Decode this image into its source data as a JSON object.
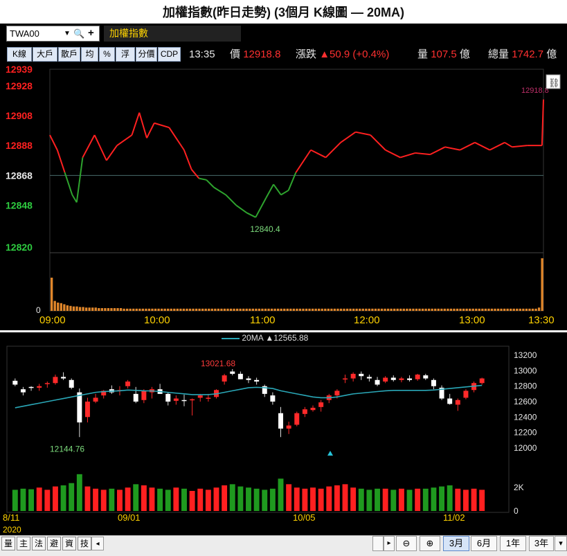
{
  "page_title": "加權指數(昨日走勢) (3個月 K線圖 — 20MA)",
  "symbol": {
    "code": "TWA00",
    "name": "加權指數"
  },
  "toolbar_buttons": [
    "K線",
    "大戶",
    "散戶",
    "均",
    "%",
    "浮",
    "分價",
    "CDP"
  ],
  "quote": {
    "time": "13:35",
    "price_label": "價",
    "price": "12918.8",
    "change_label": "漲跌",
    "change": "▲50.9 (+0.4%)",
    "volume_label": "量",
    "volume": "107.5",
    "unit1": "億",
    "total_label": "總量",
    "total": "1742.7",
    "unit2": "億"
  },
  "colors": {
    "up": "#ff2020",
    "down": "#1f9a1f",
    "ma": "#2aa8b8",
    "reference": "#4a6b6b"
  },
  "chart_data": [
    {
      "type": "line",
      "title": "intraday",
      "reference_price": 12868,
      "ylim": [
        12820,
        12939
      ],
      "y_ticks": [
        12939,
        12928,
        12908,
        12888,
        12868,
        12848,
        12820
      ],
      "x_ticks": [
        "09:00",
        "10:00",
        "11:00",
        "12:00",
        "13:00",
        "13:30"
      ],
      "min_label": "12840.4",
      "last_label": "12918.8",
      "volume_ylim_label": "0",
      "points": [
        [
          0,
          12895
        ],
        [
          5,
          12885
        ],
        [
          10,
          12870
        ],
        [
          15,
          12855
        ],
        [
          18,
          12850
        ],
        [
          22,
          12880
        ],
        [
          30,
          12895
        ],
        [
          38,
          12878
        ],
        [
          45,
          12888
        ],
        [
          55,
          12895
        ],
        [
          60,
          12910
        ],
        [
          65,
          12893
        ],
        [
          70,
          12903
        ],
        [
          80,
          12900
        ],
        [
          90,
          12885
        ],
        [
          95,
          12872
        ],
        [
          100,
          12866
        ],
        [
          105,
          12865
        ],
        [
          110,
          12860
        ],
        [
          118,
          12855
        ],
        [
          125,
          12848
        ],
        [
          132,
          12843
        ],
        [
          138,
          12840
        ],
        [
          145,
          12853
        ],
        [
          150,
          12862
        ],
        [
          155,
          12855
        ],
        [
          160,
          12858
        ],
        [
          165,
          12870
        ],
        [
          175,
          12885
        ],
        [
          185,
          12880
        ],
        [
          195,
          12890
        ],
        [
          205,
          12897
        ],
        [
          215,
          12895
        ],
        [
          225,
          12885
        ],
        [
          235,
          12880
        ],
        [
          245,
          12883
        ],
        [
          255,
          12882
        ],
        [
          265,
          12887
        ],
        [
          275,
          12885
        ],
        [
          285,
          12890
        ],
        [
          295,
          12885
        ],
        [
          305,
          12890
        ],
        [
          310,
          12887
        ],
        [
          320,
          12888
        ],
        [
          330,
          12888
        ],
        [
          331,
          12918.8
        ]
      ],
      "volume": [
        60,
        18,
        15,
        14,
        12,
        10,
        9,
        8,
        8,
        7,
        7,
        6,
        6,
        6,
        6,
        5,
        5,
        5,
        5,
        5,
        5,
        5,
        5,
        4,
        4,
        4,
        4,
        4,
        4,
        4,
        4,
        4,
        4,
        4,
        4,
        4,
        4,
        4,
        4,
        4,
        4,
        4,
        4,
        4,
        4,
        4,
        4,
        4,
        4,
        4,
        4,
        4,
        4,
        4,
        4,
        4,
        4,
        4,
        4,
        4,
        4,
        4,
        4,
        4,
        4,
        4,
        4,
        4,
        4,
        4,
        4,
        4,
        4,
        4,
        4,
        4,
        4,
        4,
        4,
        4,
        4,
        4,
        4,
        4,
        4,
        4,
        4,
        4,
        4,
        4,
        4,
        4,
        4,
        4,
        4,
        4,
        4,
        4,
        4,
        4,
        4,
        4,
        4,
        4,
        4,
        4,
        4,
        4,
        4,
        4,
        4,
        4,
        4,
        4,
        4,
        4,
        4,
        4,
        4,
        4,
        4,
        4,
        4,
        4,
        4,
        4,
        4,
        4,
        4,
        4,
        4,
        4,
        4,
        4,
        4,
        4,
        4,
        4,
        4,
        4,
        4,
        4,
        4,
        4,
        4,
        4,
        4,
        4,
        4,
        4,
        4,
        4,
        4,
        4,
        4,
        6,
        95
      ]
    },
    {
      "type": "candlestick",
      "legend": "20MA",
      "legend_value": "▲12565.88",
      "ylim": [
        11900,
        13300
      ],
      "y_ticks": [
        13200,
        13000,
        12800,
        12600,
        12400,
        12200,
        12000
      ],
      "volume_tick": "2K",
      "volume_zero": "0",
      "x_ticks": [
        "8/11",
        "09/01",
        "10/05",
        "11/02"
      ],
      "year_label": "2020",
      "max_label": "13021.68",
      "min_label": "12144.76",
      "candles": [
        [
          12870,
          12900,
          12800,
          12820
        ],
        [
          12760,
          12790,
          12680,
          12720
        ],
        [
          12790,
          12800,
          12740,
          12780
        ],
        [
          12780,
          12830,
          12740,
          12800
        ],
        [
          12830,
          12860,
          12780,
          12840
        ],
        [
          12840,
          12950,
          12820,
          12920
        ],
        [
          12920,
          12980,
          12880,
          12900
        ],
        [
          12880,
          12900,
          12760,
          12780
        ],
        [
          12720,
          12770,
          12140,
          12330
        ],
        [
          12400,
          12650,
          12330,
          12600
        ],
        [
          12600,
          12700,
          12580,
          12650
        ],
        [
          12680,
          12750,
          12640,
          12740
        ],
        [
          12760,
          12810,
          12700,
          12720
        ],
        [
          12740,
          12800,
          12680,
          12750
        ],
        [
          12800,
          12880,
          12770,
          12860
        ],
        [
          12700,
          12790,
          12580,
          12600
        ],
        [
          12620,
          12760,
          12580,
          12740
        ],
        [
          12720,
          12790,
          12640,
          12760
        ],
        [
          12760,
          12830,
          12700,
          12700
        ],
        [
          12700,
          12720,
          12550,
          12600
        ],
        [
          12610,
          12680,
          12560,
          12640
        ],
        [
          12620,
          12690,
          12540,
          12610
        ],
        [
          12620,
          12640,
          12420,
          12630
        ],
        [
          12650,
          12700,
          12600,
          12680
        ],
        [
          12640,
          12700,
          12600,
          12650
        ],
        [
          12660,
          12760,
          12640,
          12750
        ],
        [
          12860,
          12960,
          12820,
          12940
        ],
        [
          12990,
          13021,
          12940,
          12960
        ],
        [
          12960,
          12990,
          12890,
          12890
        ],
        [
          12900,
          12930,
          12840,
          12880
        ],
        [
          12880,
          12910,
          12820,
          12860
        ],
        [
          12800,
          12820,
          12660,
          12700
        ],
        [
          12680,
          12720,
          12560,
          12600
        ],
        [
          12450,
          12530,
          12140,
          12250
        ],
        [
          12250,
          12340,
          12180,
          12290
        ],
        [
          12300,
          12470,
          12280,
          12450
        ],
        [
          12440,
          12530,
          12400,
          12500
        ],
        [
          12490,
          12550,
          12470,
          12520
        ],
        [
          12530,
          12620,
          12470,
          12590
        ],
        [
          12620,
          12700,
          12580,
          12680
        ],
        [
          12680,
          12760,
          12640,
          12740
        ],
        [
          12890,
          12950,
          12840,
          12900
        ],
        [
          12900,
          12980,
          12860,
          12960
        ],
        [
          12960,
          12990,
          12880,
          12930
        ],
        [
          12920,
          12950,
          12860,
          12900
        ],
        [
          12880,
          12920,
          12800,
          12820
        ],
        [
          12860,
          12930,
          12840,
          12910
        ],
        [
          12910,
          12940,
          12860,
          12880
        ],
        [
          12880,
          12920,
          12850,
          12900
        ],
        [
          12900,
          12940,
          12860,
          12880
        ],
        [
          12890,
          12960,
          12870,
          12950
        ],
        [
          12940,
          12960,
          12880,
          12900
        ],
        [
          12880,
          12900,
          12760,
          12800
        ],
        [
          12780,
          12810,
          12620,
          12640
        ],
        [
          12640,
          12700,
          12560,
          12570
        ],
        [
          12560,
          12640,
          12480,
          12620
        ],
        [
          12650,
          12760,
          12630,
          12740
        ],
        [
          12750,
          12860,
          12720,
          12840
        ],
        [
          12840,
          12910,
          12820,
          12900
        ]
      ],
      "ma20": [
        12520,
        12540,
        12560,
        12580,
        12600,
        12620,
        12640,
        12660,
        12680,
        12700,
        12720,
        12730,
        12735,
        12740,
        12750,
        12745,
        12740,
        12738,
        12730,
        12720,
        12710,
        12700,
        12690,
        12690,
        12690,
        12700,
        12720,
        12740,
        12760,
        12780,
        12785,
        12780,
        12770,
        12740,
        12720,
        12700,
        12680,
        12660,
        12650,
        12650,
        12660,
        12680,
        12700,
        12710,
        12720,
        12730,
        12740,
        12745,
        12745,
        12745,
        12745,
        12745,
        12750,
        12760,
        12770,
        12780,
        12790,
        12800,
        12810
      ],
      "volume": [
        1900,
        2000,
        1950,
        2100,
        1900,
        2200,
        2300,
        2500,
        3300,
        2200,
        2000,
        1900,
        2000,
        1900,
        2100,
        2400,
        2300,
        2100,
        2000,
        1900,
        2100,
        2000,
        1800,
        2000,
        1900,
        2100,
        2300,
        2400,
        2200,
        2100,
        2000,
        1900,
        2000,
        2900,
        2400,
        2100,
        2000,
        2100,
        2000,
        2200,
        2300,
        2400,
        2100,
        2000,
        1900,
        2000,
        2000,
        1900,
        2000,
        1900,
        2000,
        2000,
        2100,
        2200,
        2300,
        2000,
        1900,
        2000,
        1900
      ]
    }
  ],
  "bottom_tabs": [
    "量",
    "主",
    "法",
    "避",
    "資",
    "技"
  ],
  "scroll_left": "◂",
  "scroll_right": "▸",
  "zoom_out": "⊖",
  "zoom_in": "⊕",
  "ranges": [
    "3月",
    "6月",
    "1年",
    "3年"
  ],
  "range_dropdown": "▾"
}
